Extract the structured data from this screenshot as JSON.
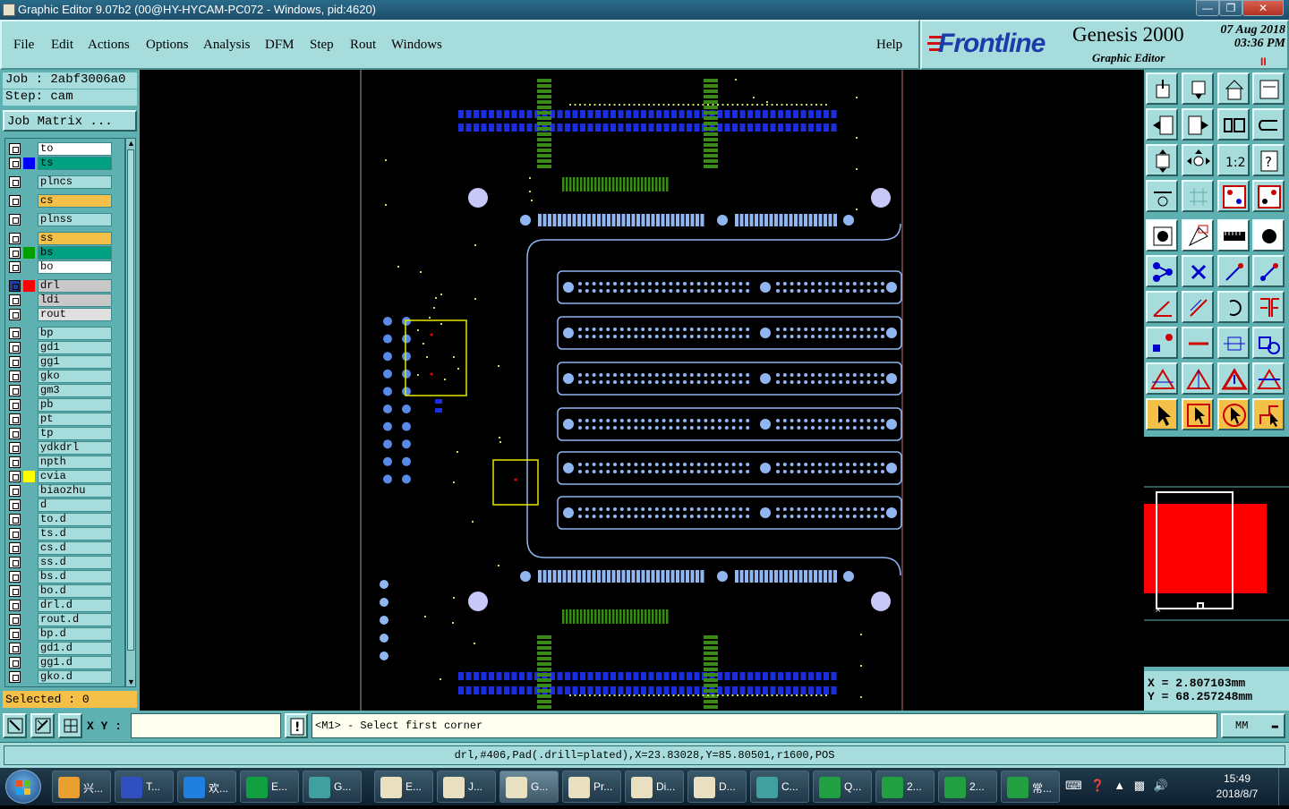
{
  "window": {
    "title": "Graphic Editor 9.07b2 (00@HY-HYCAM-PC072 - Windows, pid:4620)"
  },
  "menu": [
    "File",
    "Edit",
    "Actions",
    "Options",
    "Analysis",
    "DFM",
    "Step",
    "Rout",
    "Windows"
  ],
  "help": "Help",
  "brand": {
    "logo": "Frontline",
    "product": "Genesis 2000",
    "subtitle": "Graphic Editor",
    "date": "07 Aug 2018",
    "time": "03:36 PM",
    "pause": "II"
  },
  "job": {
    "job_label": "Job : 2abf3006a0",
    "step_label": "Step: cam",
    "matrix_button": "Job Matrix ..."
  },
  "layers": [
    {
      "name": "to",
      "color": "",
      "bg": "#ffffff"
    },
    {
      "name": "ts",
      "color": "#0000ff",
      "bg": "#00a080"
    },
    {
      "name": "plncs",
      "color": "",
      "bg": "#a7dcdc"
    },
    {
      "name": "cs",
      "color": "",
      "bg": "#f4c048"
    },
    {
      "name": "plnss",
      "color": "",
      "bg": "#a7dcdc"
    },
    {
      "name": "ss",
      "color": "",
      "bg": "#f4c048"
    },
    {
      "name": "bs",
      "color": "#00a000",
      "bg": "#00a080"
    },
    {
      "name": "bo",
      "color": "",
      "bg": "#ffffff"
    },
    {
      "name": "drl",
      "color": "#ff0000",
      "bg": "#c8c8c8"
    },
    {
      "name": "ldi",
      "color": "",
      "bg": "#c8c8c8"
    },
    {
      "name": "rout",
      "color": "",
      "bg": "#e0e0e0"
    },
    {
      "name": "bp",
      "color": "",
      "bg": "#a7dcdc"
    },
    {
      "name": "gd1",
      "color": "",
      "bg": "#a7dcdc"
    },
    {
      "name": "gg1",
      "color": "",
      "bg": "#a7dcdc"
    },
    {
      "name": "gko",
      "color": "",
      "bg": "#a7dcdc"
    },
    {
      "name": "gm3",
      "color": "",
      "bg": "#a7dcdc"
    },
    {
      "name": "pb",
      "color": "",
      "bg": "#a7dcdc"
    },
    {
      "name": "pt",
      "color": "",
      "bg": "#a7dcdc"
    },
    {
      "name": "tp",
      "color": "",
      "bg": "#a7dcdc"
    },
    {
      "name": "ydkdrl",
      "color": "",
      "bg": "#a7dcdc"
    },
    {
      "name": "npth",
      "color": "",
      "bg": "#a7dcdc"
    },
    {
      "name": "cvia",
      "color": "#ffff00",
      "bg": "#a7dcdc"
    },
    {
      "name": "biaozhu",
      "color": "",
      "bg": "#a7dcdc"
    },
    {
      "name": "d",
      "color": "",
      "bg": "#a7dcdc"
    },
    {
      "name": "to.d",
      "color": "",
      "bg": "#a7dcdc"
    },
    {
      "name": "ts.d",
      "color": "",
      "bg": "#a7dcdc"
    },
    {
      "name": "cs.d",
      "color": "",
      "bg": "#a7dcdc"
    },
    {
      "name": "ss.d",
      "color": "",
      "bg": "#a7dcdc"
    },
    {
      "name": "bs.d",
      "color": "",
      "bg": "#a7dcdc"
    },
    {
      "name": "bo.d",
      "color": "",
      "bg": "#a7dcdc"
    },
    {
      "name": "drl.d",
      "color": "",
      "bg": "#a7dcdc"
    },
    {
      "name": "rout.d",
      "color": "",
      "bg": "#a7dcdc"
    },
    {
      "name": "bp.d",
      "color": "",
      "bg": "#a7dcdc"
    },
    {
      "name": "gd1.d",
      "color": "",
      "bg": "#a7dcdc"
    },
    {
      "name": "gg1.d",
      "color": "",
      "bg": "#a7dcdc"
    },
    {
      "name": "gko.d",
      "color": "",
      "bg": "#a7dcdc"
    }
  ],
  "selected": "Selected : 0",
  "coords": {
    "x": "X = 2.807103mm",
    "y": "Y = 68.257248mm"
  },
  "command": {
    "xy_label": "X Y :",
    "xy_value": "",
    "prompt": "<M1> - Select first corner",
    "units": "MM"
  },
  "status": "drl,#406,Pad(.drill=plated),X=23.83028,Y=85.80501,r1600,POS",
  "taskbar": {
    "items": [
      {
        "label": "兴...",
        "color": "#e8a030"
      },
      {
        "label": "T...",
        "color": "#3050c0"
      },
      {
        "label": "欢...",
        "color": "#2080e0"
      },
      {
        "label": "E...",
        "color": "#10a040"
      },
      {
        "label": "G...",
        "color": "#40a0a0"
      },
      {
        "label": "E...",
        "color": "#e8e0c0"
      },
      {
        "label": "J...",
        "color": "#e8e0c0"
      },
      {
        "label": "G...",
        "color": "#e8e0c0"
      },
      {
        "label": "Pr...",
        "color": "#e8e0c0"
      },
      {
        "label": "Di...",
        "color": "#e8e0c0"
      },
      {
        "label": "D...",
        "color": "#e8e0c0"
      },
      {
        "label": "C...",
        "color": "#40a0a0"
      },
      {
        "label": "Q...",
        "color": "#20a040"
      },
      {
        "label": "2...",
        "color": "#20a040"
      },
      {
        "label": "2...",
        "color": "#20a040"
      },
      {
        "label": "常...",
        "color": "#20a040"
      }
    ],
    "time": "15:49",
    "date": "2018/8/7"
  }
}
